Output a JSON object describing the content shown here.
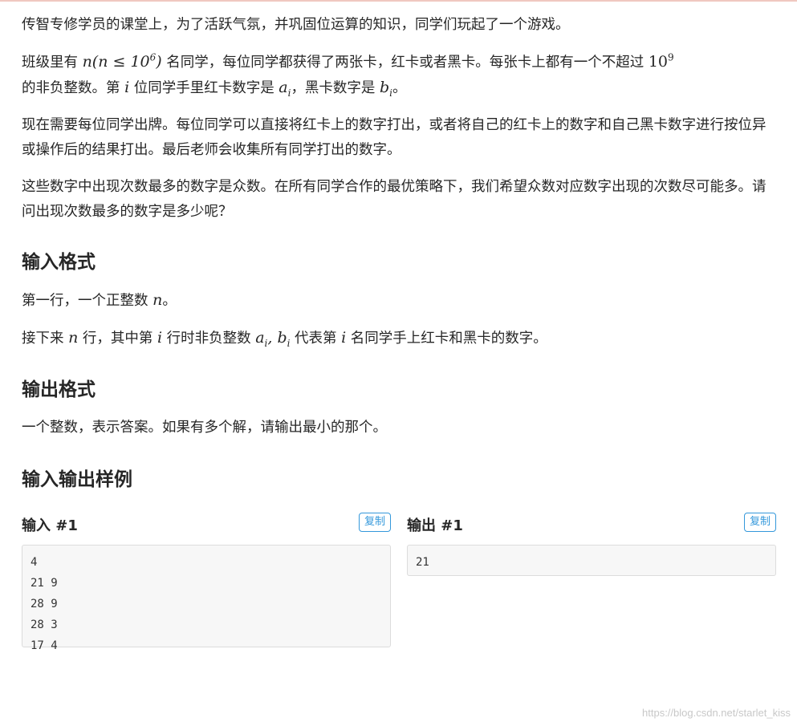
{
  "intro": {
    "p1": "传智专修学员的课堂上，为了活跃气氛，并巩固位运算的知识，同学们玩起了一个游戏。",
    "p2_a": "班级里有 ",
    "p2_math1": "n(n ≤ 10",
    "p2_exp1": "6",
    "p2_math1_end": ")",
    "p2_b": " 名同学，每位同学都获得了两张卡，红卡或者黑卡。每张卡上都有一个不超过 ",
    "p2_math2": "10",
    "p2_exp2": "9",
    "p2_c": "的非负整数。第 ",
    "p2_var_i": "i",
    "p2_d": " 位同学手里红卡数字是 ",
    "p2_var_a": "a",
    "p2_sub_i1": "i",
    "p2_e": "，黑卡数字是 ",
    "p2_var_b": "b",
    "p2_sub_i2": "i",
    "p2_f": "。",
    "p3": "现在需要每位同学出牌。每位同学可以直接将红卡上的数字打出，或者将自己的红卡上的数字和自己黑卡数字进行按位异或操作后的结果打出。最后老师会收集所有同学打出的数字。",
    "p4": "这些数字中出现次数最多的数字是众数。在所有同学合作的最优策略下，我们希望众数对应数字出现的次数尽可能多。请问出现次数最多的数字是多少呢？"
  },
  "input_format": {
    "heading": "输入格式",
    "line1_a": "第一行，一个正整数 ",
    "line1_var": "n",
    "line1_b": "。",
    "line2_a": "接下来 ",
    "line2_var_n": "n",
    "line2_b": " 行，其中第 ",
    "line2_var_i": "i",
    "line2_c": " 行时非负整数 ",
    "line2_var_a": "a",
    "line2_sub_i1": "i",
    "line2_comma": ", ",
    "line2_var_b": "b",
    "line2_sub_i2": "i",
    "line2_d": " 代表第 ",
    "line2_var_i2": "i",
    "line2_e": " 名同学手上红卡和黑卡的数字。"
  },
  "output_format": {
    "heading": "输出格式",
    "line1": "一个整数，表示答案。如果有多个解，请输出最小的那个。"
  },
  "samples": {
    "heading": "输入输出样例",
    "input_title": "输入 #1",
    "output_title": "输出 #1",
    "copy_label": "复制",
    "input_text": "4\n21 9\n28 9\n28 3\n17 4",
    "output_text": "21"
  },
  "watermark": "https://blog.csdn.net/starlet_kiss"
}
